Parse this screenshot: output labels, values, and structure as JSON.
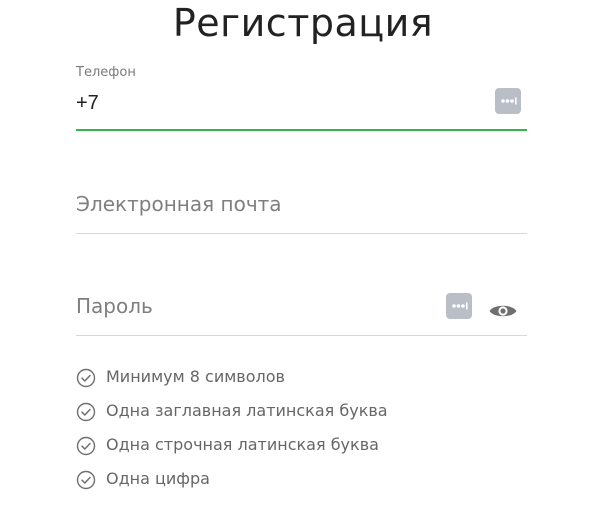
{
  "header": {
    "title": "Регистрация"
  },
  "form": {
    "phone": {
      "label": "Телефон",
      "value": "+7",
      "icon": "password-dots-icon",
      "active": true
    },
    "email": {
      "placeholder": "Электронная почта"
    },
    "password": {
      "placeholder": "Пароль",
      "icons": [
        "password-dots-icon",
        "eye-icon"
      ]
    }
  },
  "rules": {
    "items": [
      "Минимум 8 символов",
      "Одна заглавная латинская буква",
      "Одна строчная латинская буква",
      "Одна цифра"
    ],
    "icon": "check-circle-icon"
  },
  "colors": {
    "accent": "#34b44f",
    "icon_badge": "#b9bec7",
    "eye": "#6f6f6f",
    "rule_text": "#666666"
  }
}
